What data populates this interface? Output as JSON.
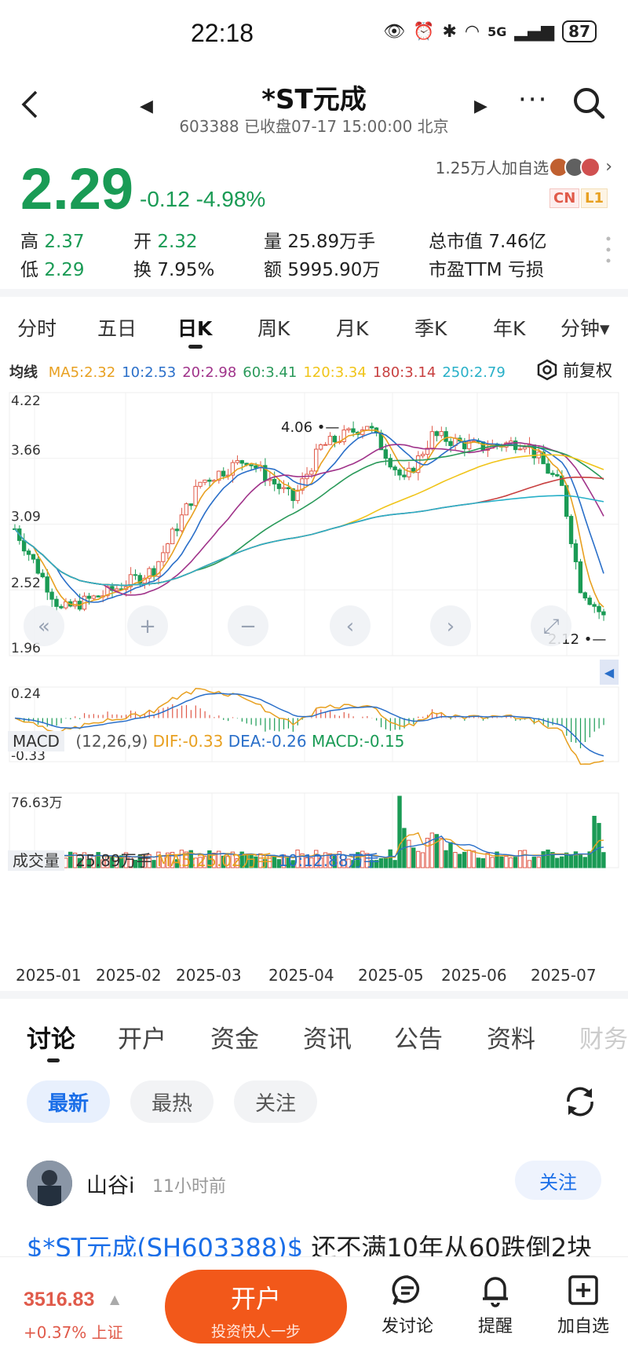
{
  "status_bar": {
    "time": "22:18",
    "network": "5G",
    "battery": "87"
  },
  "header": {
    "title": "*ST元成",
    "subtitle": "603388 已收盘07-17 15:00:00 北京"
  },
  "quote": {
    "price": "2.29",
    "change": "-0.12 -4.98%",
    "watchers": "1.25万人加自选",
    "badge_cn": "CN",
    "badge_l1": "L1",
    "colors": {
      "down": "#1a9b55",
      "up": "#e05a4a"
    }
  },
  "stats": {
    "high_label": "高",
    "high": "2.37",
    "low_label": "低",
    "low": "2.29",
    "open_label": "开",
    "open": "2.32",
    "turnover_label": "换",
    "turnover": "7.95%",
    "volume_label": "量",
    "volume": "25.89万手",
    "amount_label": "额",
    "amount": "5995.90万",
    "mktcap_label": "总市值",
    "mktcap": "7.46亿",
    "pe_label": "市盈TTM",
    "pe": "亏损"
  },
  "period_tabs": [
    "分时",
    "五日",
    "日K",
    "周K",
    "月K",
    "季K",
    "年K",
    "分钟▾"
  ],
  "ma_legend": {
    "title": "均线",
    "items": [
      {
        "label": "MA5:2.32",
        "color": "#e8a020"
      },
      {
        "label": "10:2.53",
        "color": "#2a6fc9"
      },
      {
        "label": "20:2.98",
        "color": "#a0338a"
      },
      {
        "label": "60:3.41",
        "color": "#2a9a5a"
      },
      {
        "label": "120:3.34",
        "color": "#f0c419"
      },
      {
        "label": "180:3.14",
        "color": "#c84040"
      },
      {
        "label": "250:2.79",
        "color": "#28b0c8"
      }
    ],
    "adjust": "前复权"
  },
  "chart_data": [
    {
      "type": "candlestick",
      "y_ticks": [
        "4.22",
        "3.66",
        "3.09",
        "2.52",
        "1.96"
      ],
      "ylim": [
        1.96,
        4.22
      ],
      "annotations": [
        {
          "label": "4.06",
          "kind": "high"
        },
        {
          "label": "2.12",
          "kind": "low"
        }
      ],
      "x_ticks": [
        "2025-01",
        "2025-02",
        "2025-03",
        "2025-04",
        "2025-05",
        "2025-06",
        "2025-07"
      ]
    },
    {
      "type": "bar",
      "title": "MACD",
      "params": "(12,26,9)",
      "dif": "DIF:-0.33",
      "dea": "DEA:-0.26",
      "macd": "MACD:-0.15",
      "y_ticks": [
        "0.24",
        "-0.33"
      ]
    },
    {
      "type": "bar",
      "title": "成交量",
      "current": "25.89万手",
      "ma5": "MA5:25.02万手",
      "ma10": "10:12.88万手",
      "y_ticks": [
        "76.63万"
      ]
    }
  ],
  "section_tabs": [
    "讨论",
    "开户",
    "资金",
    "资讯",
    "公告",
    "资料",
    "财务"
  ],
  "filter_pills": [
    "最新",
    "最热",
    "关注"
  ],
  "post": {
    "user": "山谷i",
    "time": "11小时前",
    "follow": "关注",
    "link": "$*ST元成(SH603388)$",
    "text": " 还不满10年从60跌倒2块"
  },
  "bottom_bar": {
    "index_value": "3516.83",
    "index_change": "+0.37% 上证",
    "open_main": "开户",
    "open_sub": "投资快人一步",
    "actions": [
      "发讨论",
      "提醒",
      "加自选"
    ]
  }
}
